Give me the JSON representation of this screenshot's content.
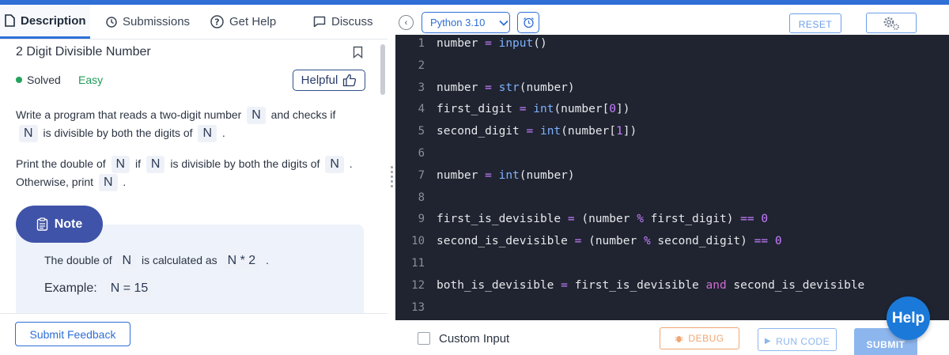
{
  "tabs": {
    "description": "Description",
    "submissions": "Submissions",
    "get_help": "Get Help",
    "discuss": "Discuss"
  },
  "problem": {
    "title": "2 Digit Divisible Number",
    "status": "Solved",
    "difficulty": "Easy",
    "helpful_label": "Helpful"
  },
  "description": {
    "p1_part1": "Write a program that reads a two-digit number",
    "p1_chip1": "N",
    "p1_part2": "and checks if",
    "p1_chip2": "N",
    "p1_part3": "is divisible by both the digits of",
    "p1_chip3": "N",
    "p1_part4": ".",
    "p2_part1": "Print the double of",
    "p2_chip1": "N",
    "p2_part2": "if",
    "p2_chip2": "N",
    "p2_part3": "is divisible by both the digits of",
    "p2_chip3": "N",
    "p2_part4": ".",
    "p3_part1": "Otherwise, print",
    "p3_chip1": "N",
    "p3_part2": "."
  },
  "note": {
    "label": "Note",
    "line_part1": "The double of",
    "line_chip1": "N",
    "line_part2": "is calculated as",
    "line_chip2": "N * 2",
    "line_part3": ".",
    "example_label": "Example:",
    "example_value": "N = 15"
  },
  "feedback_button": "Submit Feedback",
  "editor": {
    "language": "Python 3.10",
    "reset_label": "RESET",
    "lines": [
      {
        "n": "1",
        "code": "number = input()"
      },
      {
        "n": "2",
        "code": ""
      },
      {
        "n": "3",
        "code": "number = str(number)"
      },
      {
        "n": "4",
        "code": "first_digit = int(number[0])"
      },
      {
        "n": "5",
        "code": "second_digit = int(number[1])"
      },
      {
        "n": "6",
        "code": ""
      },
      {
        "n": "7",
        "code": "number = int(number)"
      },
      {
        "n": "8",
        "code": ""
      },
      {
        "n": "9",
        "code": "first_is_devisible = (number % first_digit) == 0"
      },
      {
        "n": "10",
        "code": "second_is_devisible = (number % second_digit) == 0"
      },
      {
        "n": "11",
        "code": ""
      },
      {
        "n": "12",
        "code": "both_is_devisible = first_is_devisible and second_is_devisible"
      },
      {
        "n": "13",
        "code": ""
      }
    ]
  },
  "controls": {
    "custom_input": "Custom Input",
    "debug": "DEBUG",
    "run_code": "RUN CODE",
    "submit": "SUBMIT"
  },
  "help_fab": "Help",
  "colors": {
    "accent": "#2f6fd6",
    "editor_bg": "#1f2430",
    "note_pill": "#3f53a8",
    "easy": "#1f9a5a",
    "debug": "#f0a672"
  }
}
